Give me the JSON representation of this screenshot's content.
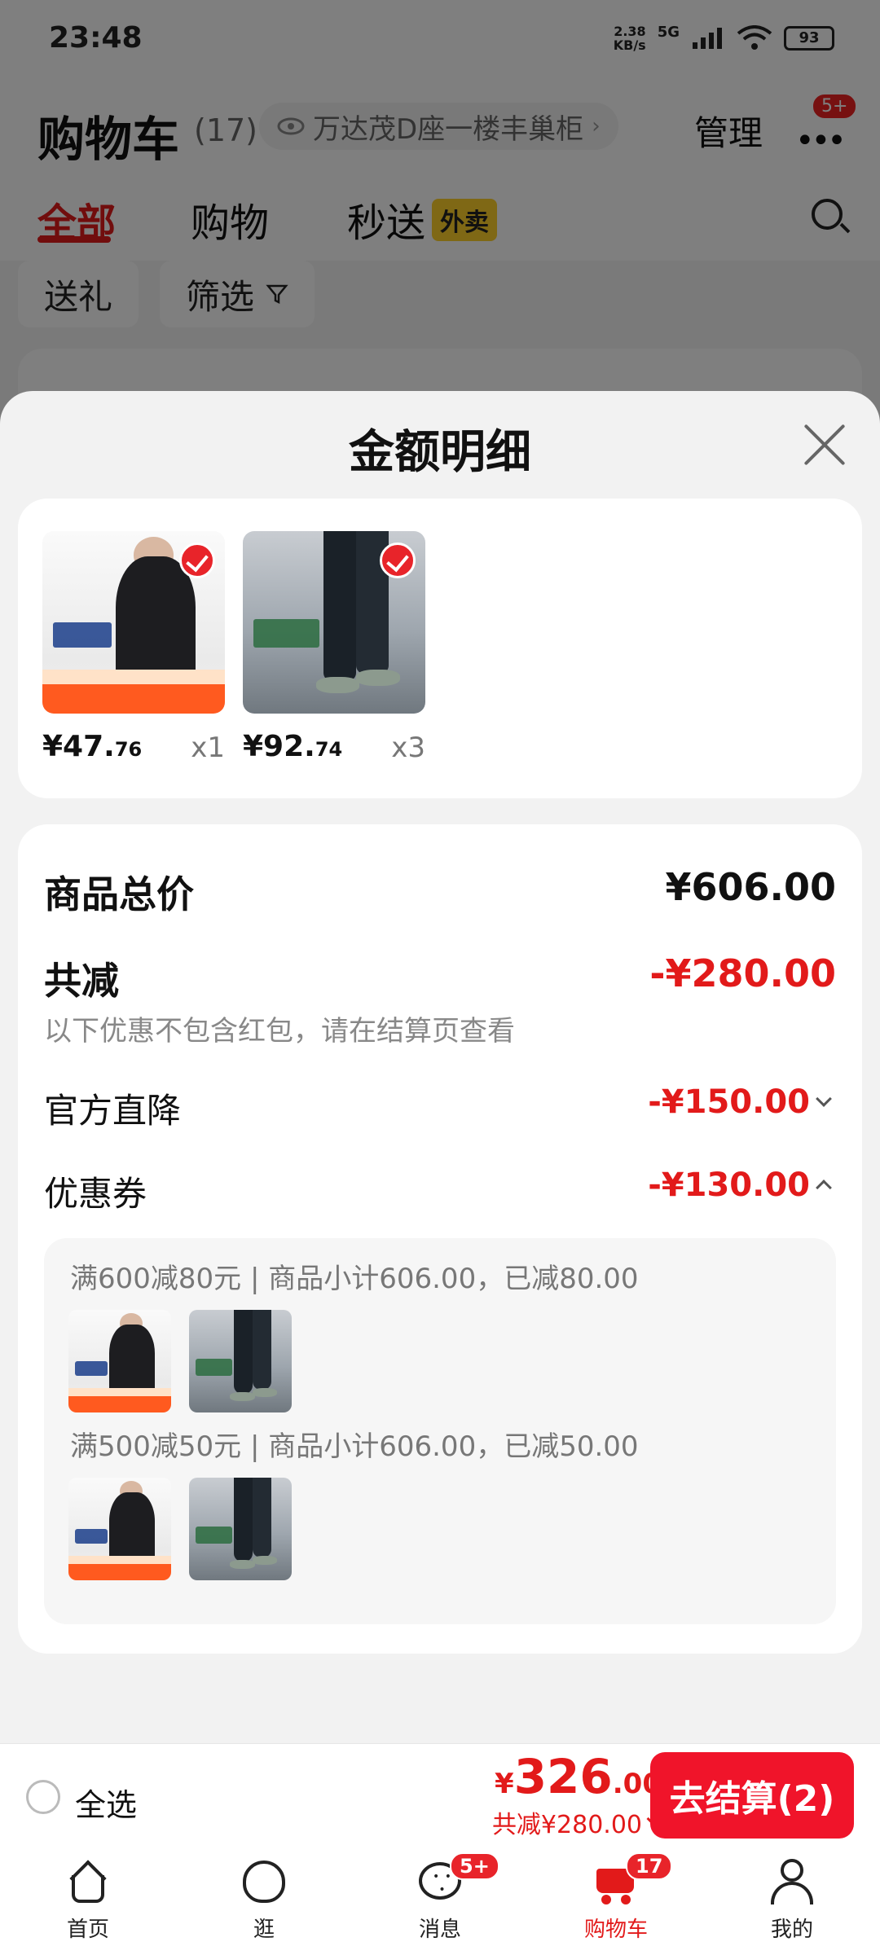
{
  "status_bar": {
    "time": "23:48",
    "net_speed_top": "2.38",
    "net_speed_unit": "KB/s",
    "network": "5G",
    "battery": "93"
  },
  "cart": {
    "title": "购物车",
    "count": "(17)",
    "store": "万达茂D座一楼丰巢柜",
    "manage": "管理",
    "more_badge": "5+",
    "tabs": [
      {
        "label": "全部"
      },
      {
        "label": "购物"
      },
      {
        "label": "秒送"
      }
    ],
    "takeout_tag": "外卖",
    "chips": [
      {
        "label": "送礼"
      },
      {
        "label": "筛选"
      }
    ]
  },
  "sheet": {
    "title": "金额明细",
    "products": [
      {
        "price_int": "¥47.",
        "price_dec": "76",
        "qty": "x1",
        "thumb": "shirt"
      },
      {
        "price_int": "¥92.",
        "price_dec": "74",
        "qty": "x3",
        "thumb": "pants"
      }
    ],
    "summary": {
      "total_label": "商品总价",
      "total_value": "¥606.00",
      "reduce_label": "共减",
      "reduce_value": "-¥280.00",
      "reduce_note": "以下优惠不包含红包，请在结算页查看",
      "official_label": "官方直降",
      "official_value": "-¥150.00",
      "coupon_label": "优惠券",
      "coupon_value": "-¥130.00"
    },
    "coupon_lines": [
      "满600减80元 | 商品小计606.00，已减80.00",
      "满500减50元 | 商品小计606.00，已减50.00"
    ]
  },
  "checkout": {
    "select_all": "全选",
    "currency": "¥",
    "amount_int": "326",
    "amount_dec": ".00",
    "reduce_text": "共减¥280.00",
    "button": "去结算(2)"
  },
  "nav": {
    "items": [
      {
        "label": "首页",
        "icon": "home-icon"
      },
      {
        "label": "逛",
        "icon": "browse-icon"
      },
      {
        "label": "消息",
        "icon": "message-icon",
        "badge": "5+"
      },
      {
        "label": "购物车",
        "icon": "cart-icon",
        "badge": "17"
      },
      {
        "label": "我的",
        "icon": "profile-icon"
      }
    ]
  },
  "colors": {
    "accent_red": "#e21a1a",
    "checkout_red": "#f0142a",
    "takeout_yellow": "#ffd02a"
  }
}
